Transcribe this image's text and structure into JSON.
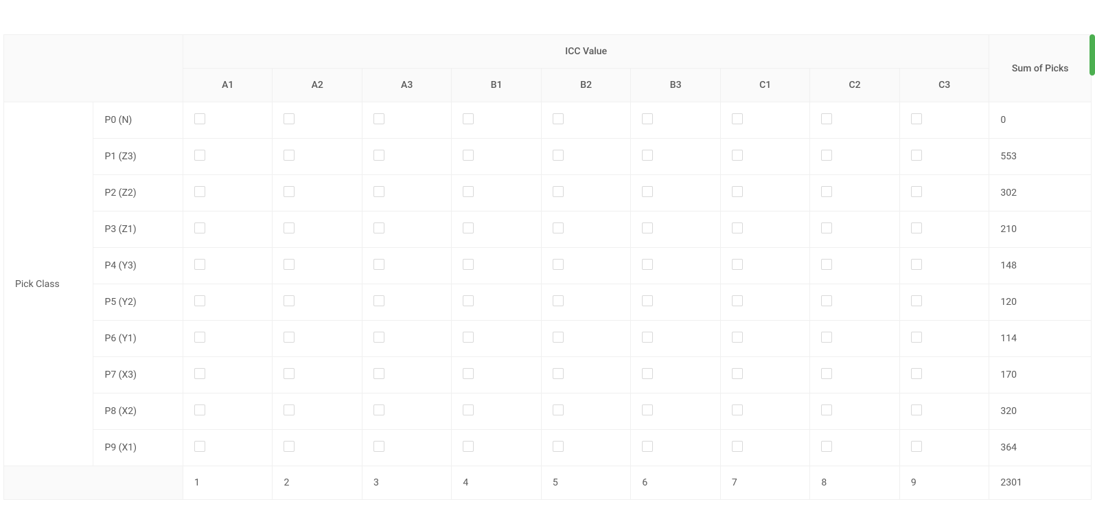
{
  "headers": {
    "rowGroupLabel": "Pick Class",
    "columnGroupLabel": "ICC Value",
    "sumLabel": "Sum of Picks",
    "columns": [
      "A1",
      "A2",
      "A3",
      "B1",
      "B2",
      "B3",
      "C1",
      "C2",
      "C3"
    ]
  },
  "rows": [
    {
      "label": "P0 (N)",
      "sum": "0"
    },
    {
      "label": "P1 (Z3)",
      "sum": "553"
    },
    {
      "label": "P2 (Z2)",
      "sum": "302"
    },
    {
      "label": "P3 (Z1)",
      "sum": "210"
    },
    {
      "label": "P4 (Y3)",
      "sum": "148"
    },
    {
      "label": "P5 (Y2)",
      "sum": "120"
    },
    {
      "label": "P6 (Y1)",
      "sum": "114"
    },
    {
      "label": "P7 (X3)",
      "sum": "170"
    },
    {
      "label": "P8 (X2)",
      "sum": "320"
    },
    {
      "label": "P9 (X1)",
      "sum": "364"
    }
  ],
  "footer": {
    "values": [
      "1",
      "2",
      "3",
      "4",
      "5",
      "6",
      "7",
      "8",
      "9"
    ],
    "total": "2301"
  }
}
